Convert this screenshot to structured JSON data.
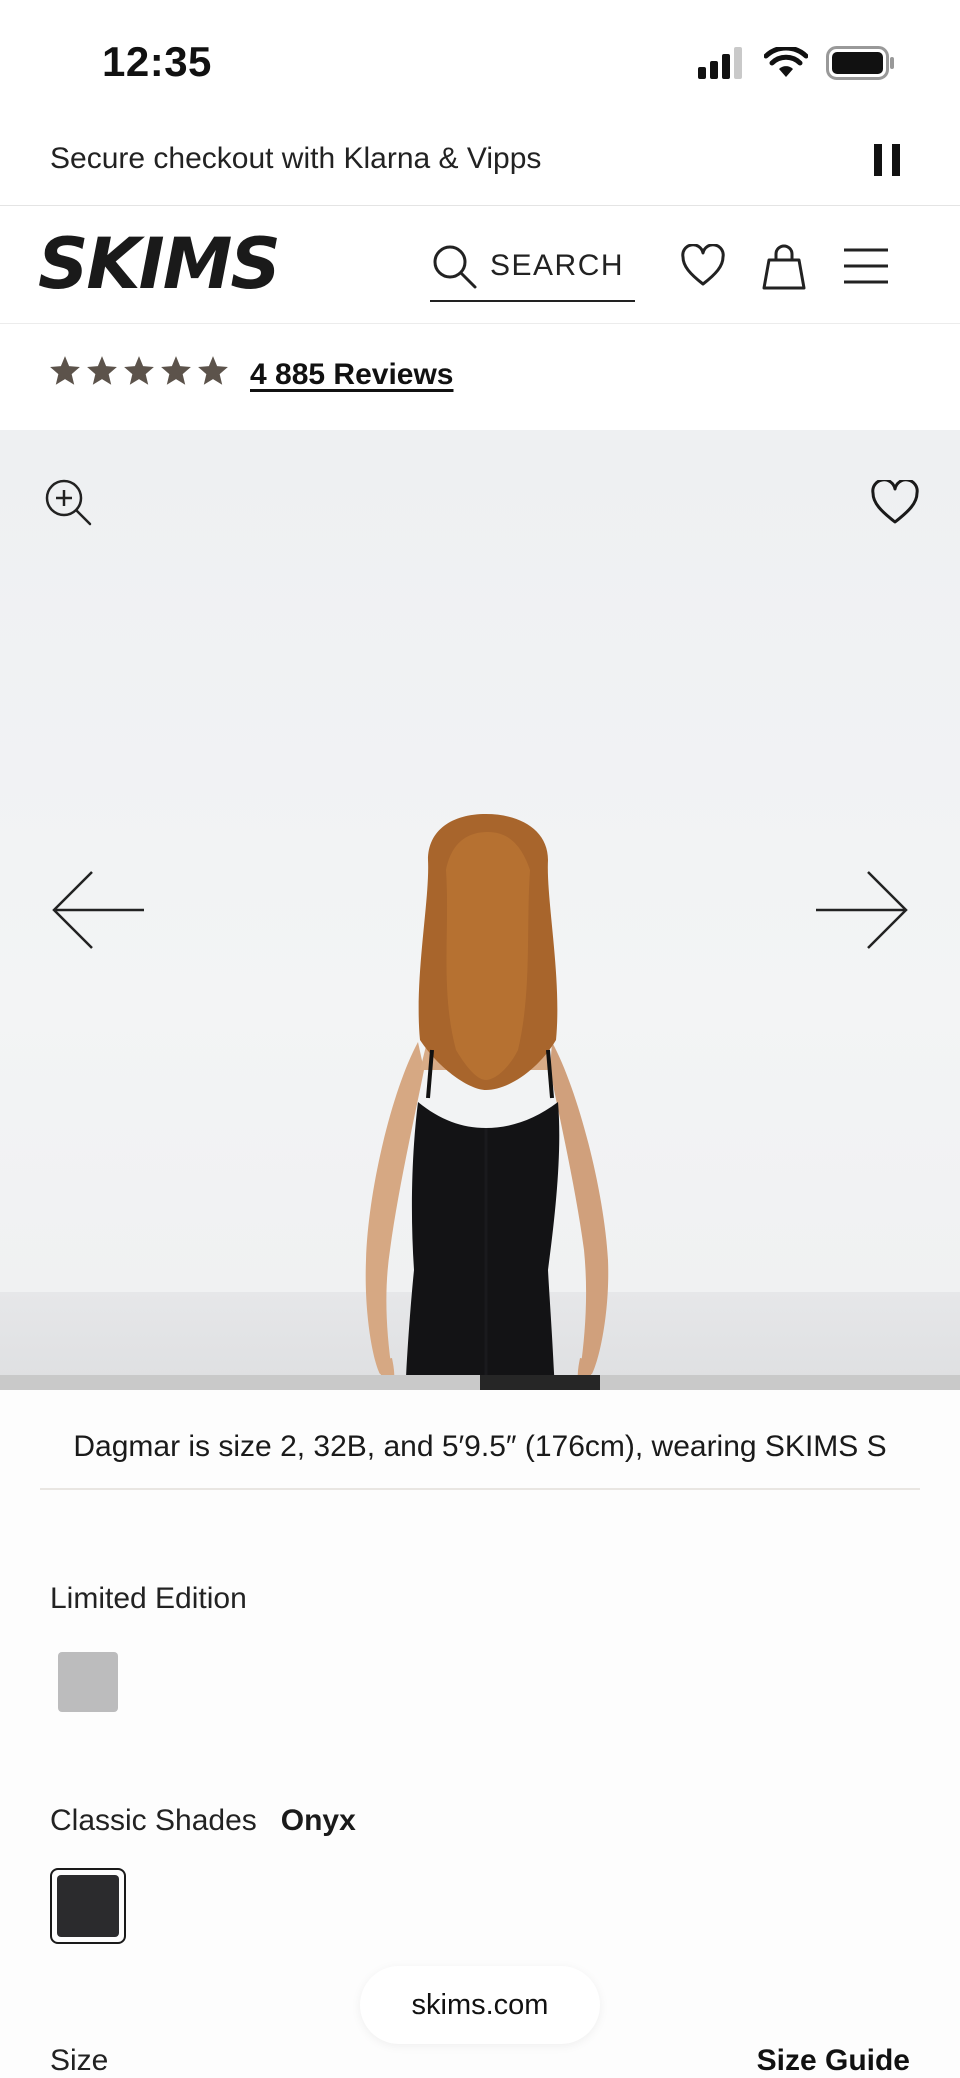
{
  "status_bar": {
    "time": "12:35",
    "icons": [
      "cellular-icon",
      "wifi-icon",
      "battery-icon"
    ]
  },
  "announcement": {
    "text": "Secure checkout with Klarna & Vipps",
    "pause_icon": "pause-icon"
  },
  "header": {
    "logo_text": "SKIMS",
    "search_label": "SEARCH",
    "icons": [
      "search-icon",
      "heart-icon",
      "bag-icon",
      "menu-icon"
    ]
  },
  "reviews": {
    "rating": 5,
    "max_rating": 5,
    "count_label": "4 885 Reviews"
  },
  "gallery": {
    "current_slide_fraction_start": 0.5,
    "current_slide_fraction_end": 0.625,
    "icons": [
      "zoom-in-icon",
      "heart-icon",
      "arrow-left-icon",
      "arrow-right-icon"
    ]
  },
  "model_info": "Dagmar is size 2, 32B, and 5′9.5″ (176cm), wearing SKIMS S",
  "limited_edition": {
    "label": "Limited Edition",
    "swatch_color": "#bcbcbd"
  },
  "classic_shades": {
    "label": "Classic Shades",
    "selected": "Onyx",
    "swatch_color": "#2b2b2d"
  },
  "size": {
    "label": "Size",
    "guide_label": "Size Guide"
  },
  "browser": {
    "url": "skims.com"
  },
  "colors": {
    "star": "#5c534b",
    "progress_track": "#c9c9c9",
    "progress_fill": "#262626"
  }
}
